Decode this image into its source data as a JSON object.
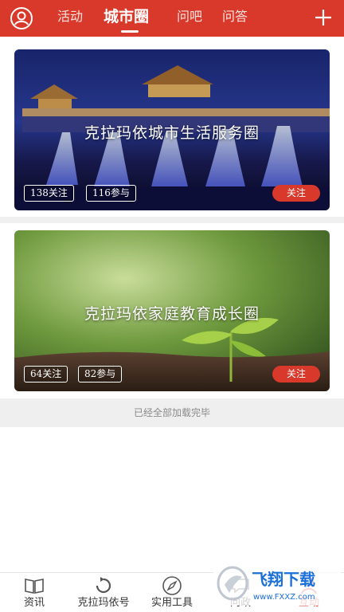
{
  "header": {
    "tabs": [
      {
        "label": "活动"
      },
      {
        "label": "城市圈"
      },
      {
        "label": "问吧"
      },
      {
        "label": "问答"
      }
    ],
    "active_tab": "城市圈"
  },
  "circles": [
    {
      "title": "克拉玛依城市生活服务圈",
      "followers": "138关注",
      "participants": "116参与",
      "follow_label": "关注"
    },
    {
      "title": "克拉玛依家庭教育成长圈",
      "followers": "64关注",
      "participants": "82参与",
      "follow_label": "关注"
    }
  ],
  "list_end_text": "已经全部加载完毕",
  "bottom_nav": {
    "items": [
      {
        "label": "资讯",
        "icon": "book-icon"
      },
      {
        "label": "克拉玛依号",
        "icon": "refresh-icon"
      },
      {
        "label": "实用工具",
        "icon": "compass-icon"
      },
      {
        "label": "问政",
        "icon": "chat-icon"
      },
      {
        "label": "互动",
        "icon": "people-icon"
      }
    ]
  },
  "watermark": {
    "brand": "飞翔下载",
    "url": "www.FXXZ.com"
  },
  "colors": {
    "accent": "#d8392b",
    "background": "#ffffff",
    "divider": "#f0f0f0"
  }
}
